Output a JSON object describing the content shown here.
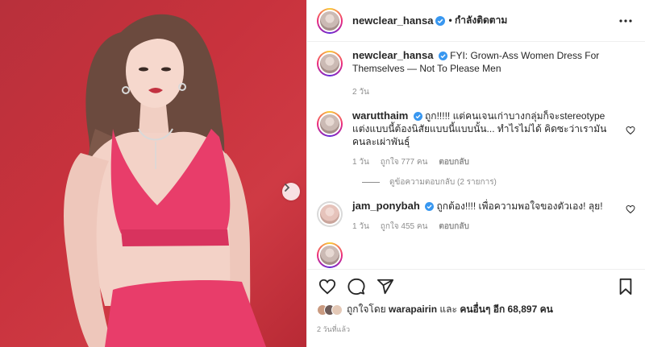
{
  "post": {
    "author": "newclear_hansa",
    "follow_state": "• กำลังติดตาม",
    "caption": "FYI: Grown-Ass Women Dress For Themselves — Not To Please Men",
    "caption_age": "2 วัน",
    "time_posted": "2 วันที่แล้ว"
  },
  "comments": [
    {
      "username": "warutthaim",
      "text": "ถูก!!!!! แต่คนเจนเก่าบางกลุ่มก็จะstereotype แต่งแบบนี้ต้องนิสัยแบบนี้แบบนั้น... ทำไรไม่ได้ คิดซะว่าเรามันคนละเผ่าพันธุ์",
      "age": "1 วัน",
      "likes": "ถูกใจ 777 คน",
      "reply_label": "ตอบกลับ",
      "view_replies": "ดูข้อความตอบกลับ (2 รายการ)"
    },
    {
      "username": "jam_ponybah",
      "text": "ถูกต้อง!!!! เพื่อความพอใจของตัวเอง! ลุย!",
      "age": "1 วัน",
      "likes": "ถูกใจ 455 คน",
      "reply_label": "ตอบกลับ"
    }
  ],
  "likes_summary": {
    "prefix": "ถูกใจโดย",
    "user": "warapairin",
    "middle": "และ",
    "others": "คนอื่นๆ อีก 68,897 คน"
  },
  "icons": {
    "verified": "verified-badge-icon",
    "more": "more-options-icon",
    "heart": "heart-icon",
    "comment": "comment-icon",
    "share": "share-icon",
    "bookmark": "bookmark-icon",
    "next": "chevron-right-icon"
  },
  "colors": {
    "verified_blue": "#3897f0",
    "photo_background": "#c8323d",
    "outfit": "#e83d6a",
    "muted_text": "#8e8e8e"
  }
}
